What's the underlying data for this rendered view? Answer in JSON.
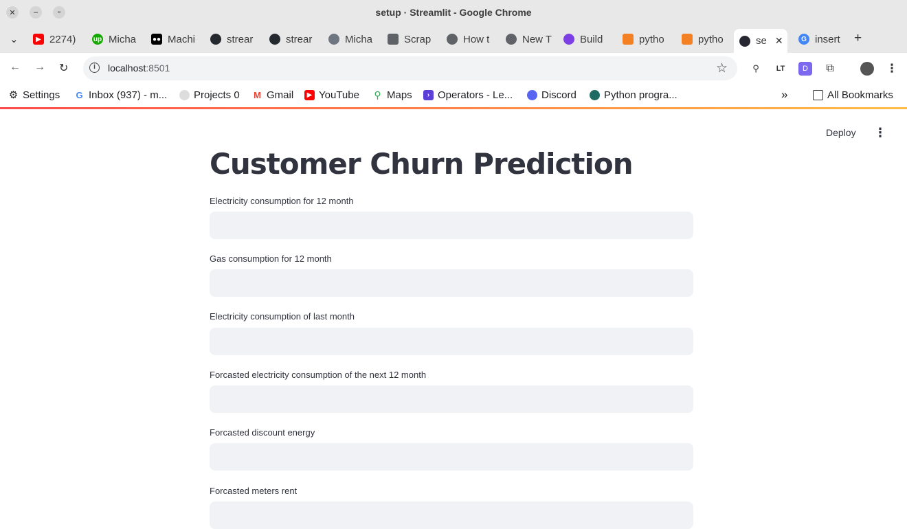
{
  "window": {
    "title": "setup · Streamlit - Google Chrome"
  },
  "tabs": [
    {
      "label": "2274)",
      "icon": "youtube-icon",
      "color": "#ff0000"
    },
    {
      "label": "Micha",
      "icon": "upwork-icon",
      "color": "#14a800"
    },
    {
      "label": "Machi",
      "icon": "medium-icon",
      "color": "#000000"
    },
    {
      "label": "strear",
      "icon": "github-icon",
      "color": "#24292f"
    },
    {
      "label": "strear",
      "icon": "github-icon",
      "color": "#24292f"
    },
    {
      "label": "Micha",
      "icon": "github-icon",
      "color": "#6e7681"
    },
    {
      "label": "Scrap",
      "icon": "document-icon",
      "color": "#5f6368"
    },
    {
      "label": "How t",
      "icon": "globe-icon",
      "color": "#5f6368"
    },
    {
      "label": "New T",
      "icon": "chrome-icon",
      "color": "#5f6368"
    },
    {
      "label": "Build",
      "icon": "settings-icon",
      "color": "#7b3fe4"
    },
    {
      "label": "pytho",
      "icon": "stackoverflow-icon",
      "color": "#f48024"
    },
    {
      "label": "pytho",
      "icon": "stackoverflow-icon",
      "color": "#f48024"
    },
    {
      "label": "se",
      "icon": "streamlit-icon",
      "color": "#262730",
      "active": true
    },
    {
      "label": "insert",
      "icon": "google-icon",
      "color": "#4285f4"
    }
  ],
  "toolbar": {
    "url_host": "localhost",
    "url_port": ":8501"
  },
  "bookmarks": [
    {
      "label": "Settings",
      "icon": "gear-icon",
      "color": "#333333"
    },
    {
      "label": "Inbox (937) - m...",
      "icon": "google-icon",
      "color": "#4285f4"
    },
    {
      "label": "Projects 0",
      "icon": "github-icon",
      "color": "#bbbbbb"
    },
    {
      "label": "Gmail",
      "icon": "gmail-icon",
      "color": "#ea4335"
    },
    {
      "label": "YouTube",
      "icon": "youtube-icon",
      "color": "#ff0000"
    },
    {
      "label": "Maps",
      "icon": "maps-icon",
      "color": "#34a853"
    },
    {
      "label": "Operators - Le...",
      "icon": "terminal-icon",
      "color": "#5b3fd8"
    },
    {
      "label": "Discord",
      "icon": "discord-icon",
      "color": "#5865f2"
    },
    {
      "label": "Python progra...",
      "icon": "python-icon",
      "color": "#1e6b63"
    },
    {
      "label": "All Bookmarks",
      "icon": "folder-icon",
      "color": "#333333"
    }
  ],
  "app": {
    "deploy_label": "Deploy",
    "title": "Customer Churn Prediction",
    "fields": [
      {
        "label": "Electricity consumption for 12 month",
        "value": ""
      },
      {
        "label": "Gas consumption for 12 month",
        "value": ""
      },
      {
        "label": "Electricity consumption of last month",
        "value": ""
      },
      {
        "label": "Forcasted electricity consumption of the next 12 month",
        "value": ""
      },
      {
        "label": "Forcasted discount energy",
        "value": ""
      },
      {
        "label": "Forcasted meters rent",
        "value": ""
      }
    ]
  }
}
